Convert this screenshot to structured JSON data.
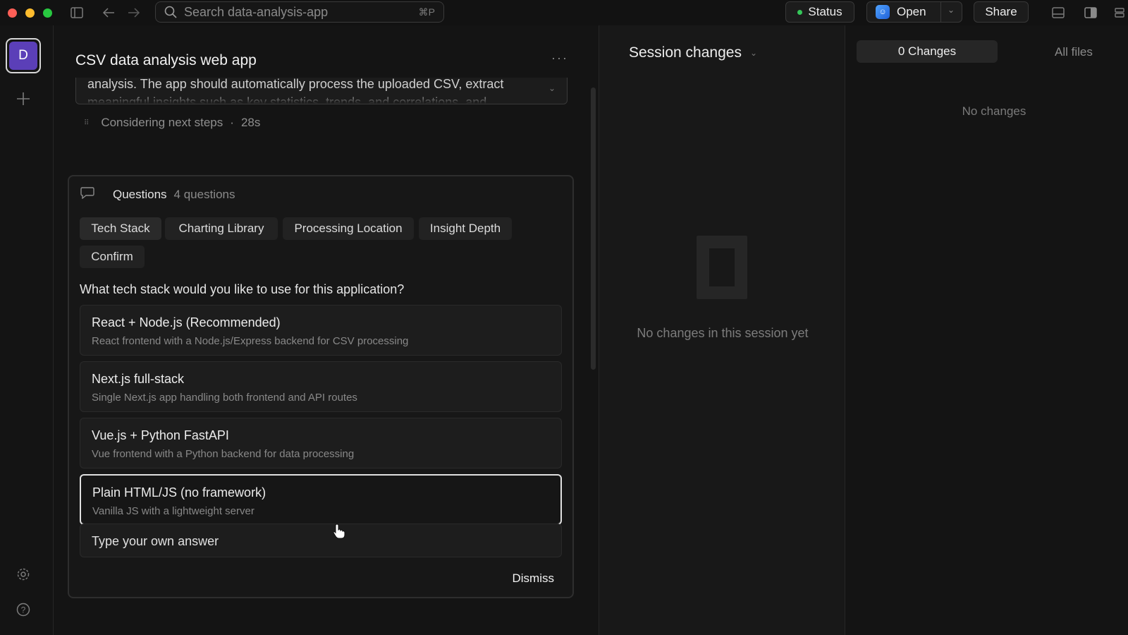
{
  "titlebar": {
    "search_placeholder": "Search data-analysis-app",
    "search_shortcut": "⌘P",
    "status_label": "Status",
    "open_label": "Open",
    "share_label": "Share"
  },
  "rail": {
    "avatar_letter": "D"
  },
  "chat": {
    "title": "CSV data analysis web app",
    "prompt_text": "analysis. The app should automatically process the uploaded CSV, extract meaningful insights such as key statistics, trends, and correlations, and",
    "thinking_label": "Considering next steps",
    "thinking_sep": "·",
    "thinking_time": "28s"
  },
  "questions": {
    "title": "Questions",
    "count": "4 questions",
    "tabs": [
      {
        "label": "Tech Stack"
      },
      {
        "label": "Charting Library"
      },
      {
        "label": "Processing Location"
      },
      {
        "label": "Insight Depth"
      },
      {
        "label": "Confirm"
      }
    ],
    "question": "What tech stack would you like to use for this application?",
    "options": [
      {
        "label": "React + Node.js (Recommended)",
        "desc": "React frontend with a Node.js/Express backend for CSV processing"
      },
      {
        "label": "Next.js full-stack",
        "desc": "Single Next.js app handling both frontend and API routes"
      },
      {
        "label": "Vue.js + Python FastAPI",
        "desc": "Vue frontend with a Python backend for data processing"
      },
      {
        "label": "Plain HTML/JS (no framework)",
        "desc": "Vanilla JS with a lightweight server"
      }
    ],
    "own_answer_placeholder": "Type your own answer",
    "dismiss_label": "Dismiss"
  },
  "session": {
    "title": "Session changes",
    "empty_text": "No changes in this session yet"
  },
  "files": {
    "changes_label": "0 Changes",
    "all_files_label": "All files",
    "no_changes_text": "No changes"
  },
  "colors": {
    "background": "#141414",
    "panel": "#181818",
    "status_green": "#35c759",
    "avatar_purple": "#5b3fb8"
  }
}
